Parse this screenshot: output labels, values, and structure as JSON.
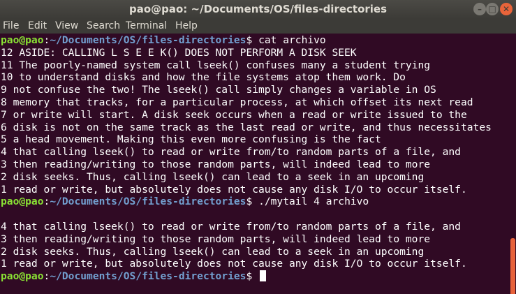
{
  "window": {
    "title": "pao@pao: ~/Documents/OS/files-directories",
    "minimize_icon": "minimize-icon",
    "maximize_icon": "maximize-icon",
    "close_icon": "close-icon",
    "minimize_glyph": "–",
    "maximize_glyph": "□",
    "close_glyph": "✕"
  },
  "menu": [
    "File",
    "Edit",
    "View",
    "Search",
    "Terminal",
    "Help"
  ],
  "colors": {
    "background": "#300a24",
    "user": "#8ae234",
    "path": "#729fcf",
    "text": "#ffffff",
    "scroll_thumb": "#e7623b"
  },
  "terminal": {
    "prompt_user": "pao@pao",
    "prompt_colon": ":",
    "prompt_path": "~/Documents/OS/files-directories",
    "prompt_suffix": "$ ",
    "lines": [
      {
        "type": "prompt",
        "command": "cat archivo"
      },
      {
        "type": "output",
        "text": "12 ASIDE: CALLING L S E E K() DOES NOT PERFORM A DISK SEEK"
      },
      {
        "type": "output",
        "text": "11 The poorly-named system call lseek() confuses many a student trying"
      },
      {
        "type": "output",
        "text": "10 to understand disks and how the file systems atop them work. Do"
      },
      {
        "type": "output",
        "text": "9 not confuse the two! The lseek() call simply changes a variable in OS"
      },
      {
        "type": "output",
        "text": "8 memory that tracks, for a particular process, at which offset its next read"
      },
      {
        "type": "output",
        "text": "7 or write will start. A disk seek occurs when a read or write issued to the"
      },
      {
        "type": "output",
        "text": "6 disk is not on the same track as the last read or write, and thus necessitates"
      },
      {
        "type": "output",
        "text": "5 a head movement. Making this even more confusing is the fact"
      },
      {
        "type": "output",
        "text": "4 that calling lseek() to read or write from/to random parts of a file, and"
      },
      {
        "type": "output",
        "text": "3 then reading/writing to those random parts, will indeed lead to more"
      },
      {
        "type": "output",
        "text": "2 disk seeks. Thus, calling lseek() can lead to a seek in an upcoming"
      },
      {
        "type": "output",
        "text": "1 read or write, but absolutely does not cause any disk I/O to occur itself."
      },
      {
        "type": "prompt",
        "command": "./mytail 4 archivo"
      },
      {
        "type": "output",
        "text": ""
      },
      {
        "type": "output",
        "text": "4 that calling lseek() to read or write from/to random parts of a file, and"
      },
      {
        "type": "output",
        "text": "3 then reading/writing to those random parts, will indeed lead to more"
      },
      {
        "type": "output",
        "text": "2 disk seeks. Thus, calling lseek() can lead to a seek in an upcoming"
      },
      {
        "type": "output",
        "text": "1 read or write, but absolutely does not cause any disk I/O to occur itself."
      },
      {
        "type": "prompt",
        "command": "",
        "cursor": true
      }
    ]
  }
}
